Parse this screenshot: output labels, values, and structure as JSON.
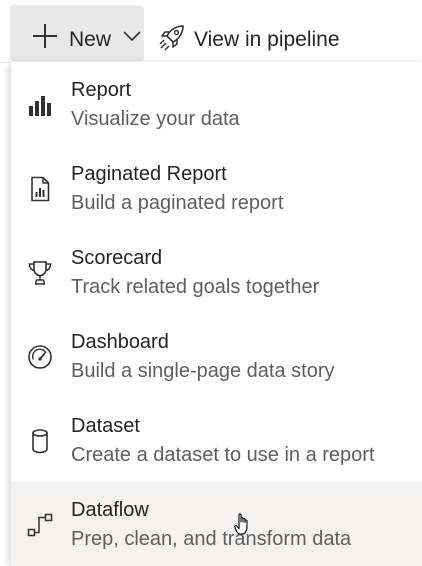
{
  "toolbar": {
    "new_label": "New",
    "pipeline_label": "View in pipeline"
  },
  "menu": {
    "items": [
      {
        "title": "Report",
        "description": "Visualize your data",
        "icon": "bar-chart-icon"
      },
      {
        "title": "Paginated Report",
        "description": "Build a paginated report",
        "icon": "paginated-report-icon"
      },
      {
        "title": "Scorecard",
        "description": "Track related goals together",
        "icon": "trophy-icon"
      },
      {
        "title": "Dashboard",
        "description": "Build a single-page data story",
        "icon": "gauge-icon"
      },
      {
        "title": "Dataset",
        "description": "Create a dataset to use in a report",
        "icon": "database-icon"
      },
      {
        "title": "Dataflow",
        "description": "Prep, clean, and transform data",
        "icon": "dataflow-icon"
      }
    ],
    "hovered_item": "Dataflow"
  },
  "colors": {
    "button_bg": "#e9e9e9",
    "hover_bg": "#f3f2f1",
    "text_primary": "#252423",
    "text_secondary": "#605e5c"
  }
}
